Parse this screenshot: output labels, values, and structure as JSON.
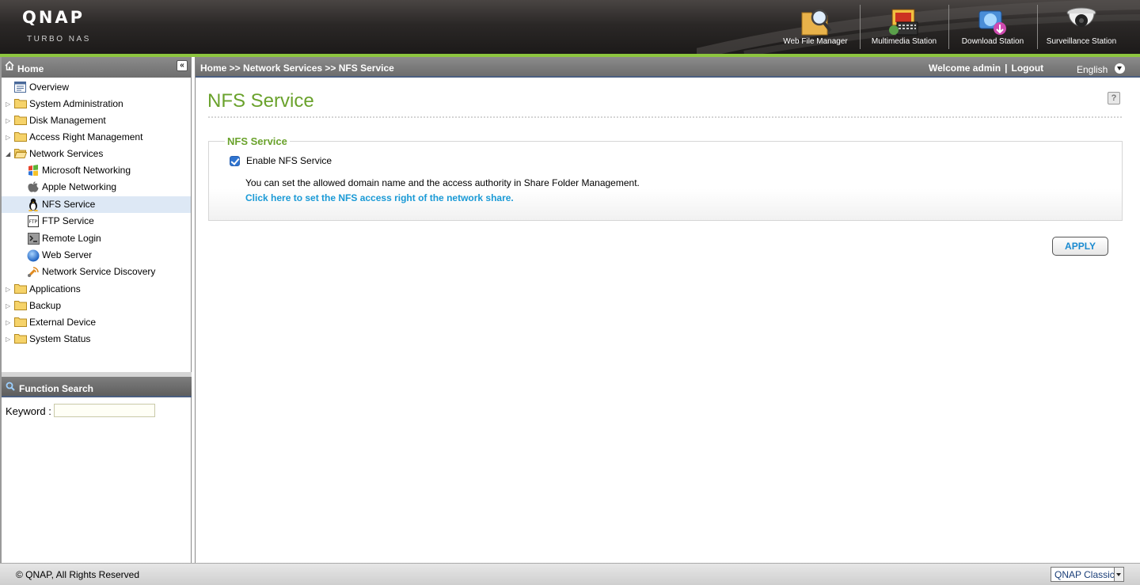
{
  "brand": {
    "logo": "QNAP",
    "subtitle": "TURBO NAS"
  },
  "apps": [
    {
      "label": "Web File Manager",
      "icon": "web-file-manager-icon"
    },
    {
      "label": "Multimedia Station",
      "icon": "multimedia-station-icon"
    },
    {
      "label": "Download Station",
      "icon": "download-station-icon"
    },
    {
      "label": "Surveillance Station",
      "icon": "surveillance-station-icon"
    }
  ],
  "sidebar": {
    "title": "Home",
    "collapse_glyph": "«",
    "items": [
      {
        "label": "Overview",
        "level": 0,
        "icon": "overview-icon"
      },
      {
        "label": "System Administration",
        "level": 0,
        "icon": "folder-icon"
      },
      {
        "label": "Disk Management",
        "level": 0,
        "icon": "folder-icon"
      },
      {
        "label": "Access Right Management",
        "level": 0,
        "icon": "folder-icon"
      },
      {
        "label": "Network Services",
        "level": 0,
        "icon": "folder-open-icon",
        "expanded": true
      },
      {
        "label": "Microsoft Networking",
        "level": 1,
        "icon": "windows-icon"
      },
      {
        "label": "Apple Networking",
        "level": 1,
        "icon": "apple-icon"
      },
      {
        "label": "NFS Service",
        "level": 1,
        "icon": "linux-penguin-icon",
        "selected": true
      },
      {
        "label": "FTP Service",
        "level": 1,
        "icon": "ftp-icon"
      },
      {
        "label": "Remote Login",
        "level": 1,
        "icon": "terminal-icon"
      },
      {
        "label": "Web Server",
        "level": 1,
        "icon": "globe-icon"
      },
      {
        "label": "Network Service Discovery",
        "level": 1,
        "icon": "satellite-icon"
      },
      {
        "label": "Applications",
        "level": 0,
        "icon": "folder-icon"
      },
      {
        "label": "Backup",
        "level": 0,
        "icon": "folder-icon"
      },
      {
        "label": "External Device",
        "level": 0,
        "icon": "folder-icon"
      },
      {
        "label": "System Status",
        "level": 0,
        "icon": "folder-icon"
      }
    ]
  },
  "search": {
    "title": "Function Search",
    "keyword_label": "Keyword :",
    "keyword_value": ""
  },
  "topbar": {
    "breadcrumb": "Home >> Network Services >> NFS Service",
    "welcome": "Welcome admin",
    "logout": "Logout",
    "language": "English"
  },
  "main": {
    "title": "NFS Service",
    "help_glyph": "?",
    "section_title": "NFS Service",
    "enable_label": "Enable NFS Service",
    "enable_checked": true,
    "description": "You can set the allowed domain name and the access authority in Share Folder Management.",
    "link": "Click here to set the NFS access right of the network share.",
    "apply": "APPLY"
  },
  "footer": {
    "copyright": "© QNAP, All Rights Reserved",
    "theme": "QNAP Classic"
  },
  "colors": {
    "accent_green": "#6aa22c",
    "header_line": "#8dc63f",
    "link_blue": "#1a9ad6",
    "selected_bg": "#dde8f5"
  }
}
